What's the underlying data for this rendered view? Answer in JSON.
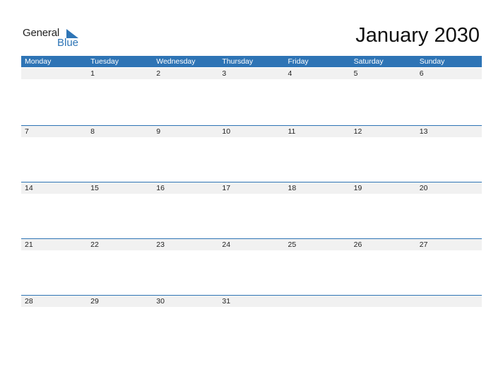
{
  "logo": {
    "word1": "General",
    "word2": "Blue"
  },
  "title": "January 2030",
  "colors": {
    "accent": "#2e74b5",
    "date_strip": "#f1f1f1"
  },
  "weekdays": [
    "Monday",
    "Tuesday",
    "Wednesday",
    "Thursday",
    "Friday",
    "Saturday",
    "Sunday"
  ],
  "weeks": [
    [
      "",
      "1",
      "2",
      "3",
      "4",
      "5",
      "6"
    ],
    [
      "7",
      "8",
      "9",
      "10",
      "11",
      "12",
      "13"
    ],
    [
      "14",
      "15",
      "16",
      "17",
      "18",
      "19",
      "20"
    ],
    [
      "21",
      "22",
      "23",
      "24",
      "25",
      "26",
      "27"
    ],
    [
      "28",
      "29",
      "30",
      "31",
      "",
      "",
      ""
    ]
  ]
}
